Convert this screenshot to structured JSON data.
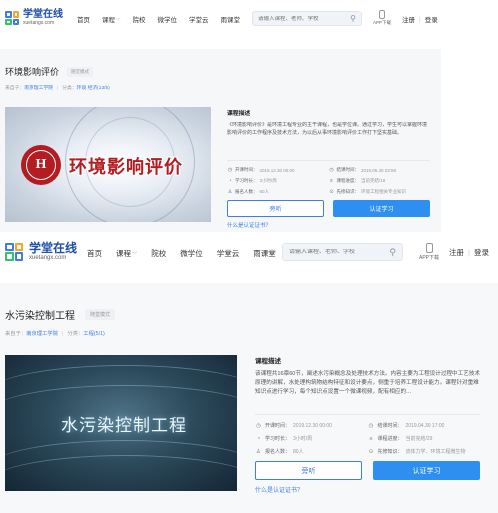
{
  "colors": {
    "accent": "#3f7ee8",
    "primary_button": "#2f8ff0",
    "seal_red": "#b31c21"
  },
  "header": {
    "logo_cn": "学堂在线",
    "logo_en": "xuetangx.com",
    "nav": [
      {
        "label": "首页",
        "dropdown": false
      },
      {
        "label": "课程",
        "dropdown": true
      },
      {
        "label": "院校",
        "dropdown": false
      },
      {
        "label": "微学位",
        "dropdown": false
      },
      {
        "label": "学堂云",
        "dropdown": false
      },
      {
        "label": "雨课堂",
        "dropdown": false
      }
    ],
    "search_placeholder": "请输入课程、老师、学校",
    "app_download": "APP下载",
    "register": "注册",
    "separator": "|",
    "login": "登录"
  },
  "courses": [
    {
      "title": "环境影响评价",
      "mode_badge": "随堂模式",
      "source_prefix": "来自于：",
      "source_link": "南京理工学院",
      "category_prefix": "分类：",
      "category_link": "环境 经济(13/5)",
      "cover_title": "环境影响评价",
      "seal_text": "H",
      "desc_heading": "课程描述",
      "desc": "《环境影响评价》是环境工程专业的主干课程，也是学位课。通过学习，学生可以掌握环境影响评价的工作程序及技术方法，为以后从事环境影响评价工作打下坚实基础。",
      "facts": [
        {
          "icon": "◷",
          "icon_name": "clock-icon",
          "label": "开课时间：",
          "value": "2019.12.30 00:00"
        },
        {
          "icon": "◷",
          "icon_name": "clock-icon",
          "label": "结课时间：",
          "value": "2019.06.30 23:59"
        },
        {
          "icon": "◔",
          "icon_name": "duration-icon",
          "label": "学习时长：",
          "value": "3小时/周"
        },
        {
          "icon": "≡",
          "icon_name": "progress-icon",
          "label": "课程进度：",
          "value": "当前完结/18"
        },
        {
          "icon": "♙",
          "icon_name": "user-icon",
          "label": "报名人数：",
          "value": "60人"
        },
        {
          "icon": "⊙",
          "icon_name": "knowledge-icon",
          "label": "先修知识：",
          "value": "环境工程相关专业知识"
        }
      ],
      "audit_label": "旁听",
      "learn_label": "认证学习",
      "cert_link": "什么是认证证书？"
    },
    {
      "title": "水污染控制工程",
      "mode_badge": "随堂模式",
      "source_prefix": "来自于：",
      "source_link": "南京理工学院",
      "category_prefix": "分类：",
      "category_link": "工程(5/1)",
      "cover_title": "水污染控制工程",
      "desc_heading": "课程描述",
      "desc": "该课程共16章60节，阐述水污染概念及处理技术方法。内容主要为工程设计过程中工艺技术原理的讲解，水处理构筑物结构特征和设计要点，侧重于培养工程设计能力。课程针对重难知识点进行学习，每个知识点设置一个微课视频，配有相应的…",
      "facts": [
        {
          "icon": "◷",
          "icon_name": "clock-icon",
          "label": "开课时间：",
          "value": "2019.12.30 00:00"
        },
        {
          "icon": "◷",
          "icon_name": "clock-icon",
          "label": "结课时间：",
          "value": "2019.04.30 17:00"
        },
        {
          "icon": "◔",
          "icon_name": "duration-icon",
          "label": "学习时长：",
          "value": "3小时/周"
        },
        {
          "icon": "≡",
          "icon_name": "progress-icon",
          "label": "课程进度：",
          "value": "当前完结/29"
        },
        {
          "icon": "♙",
          "icon_name": "user-icon",
          "label": "报名人数：",
          "value": "80人"
        },
        {
          "icon": "⊙",
          "icon_name": "knowledge-icon",
          "label": "先修知识：",
          "value": "流体力学、环境工程微生物"
        }
      ],
      "audit_label": "旁听",
      "learn_label": "认证学习",
      "cert_link": "什么是认证证书？"
    }
  ]
}
